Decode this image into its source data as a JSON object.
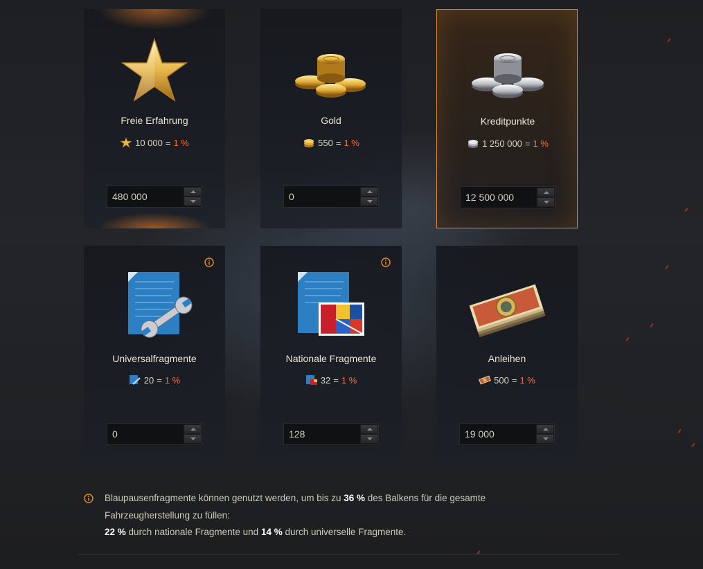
{
  "cards": [
    {
      "title": "Freie Erfahrung",
      "rate_amount": "10 000",
      "rate_equals": "=",
      "rate_percent": "1 %",
      "value": "480 000",
      "icon": "star-icon",
      "selected": false
    },
    {
      "title": "Gold",
      "rate_amount": "550",
      "rate_equals": "=",
      "rate_percent": "1 %",
      "value": "0",
      "icon": "gold-coins-icon",
      "selected": false
    },
    {
      "title": "Kreditpunkte",
      "rate_amount": "1 250 000",
      "rate_equals": "=",
      "rate_percent": "1 %",
      "value": "12 500 000",
      "icon": "silver-coins-icon",
      "selected": true
    },
    {
      "title": "Universalfragmente",
      "rate_amount": "20",
      "rate_equals": "=",
      "rate_percent": "1 %",
      "value": "0",
      "icon": "universal-blueprint-icon",
      "selected": false,
      "has_info": true
    },
    {
      "title": "Nationale Fragmente",
      "rate_amount": "32",
      "rate_equals": "=",
      "rate_percent": "1 %",
      "value": "128",
      "icon": "national-blueprint-icon",
      "selected": false,
      "has_info": true
    },
    {
      "title": "Anleihen",
      "rate_amount": "500",
      "rate_equals": "=",
      "rate_percent": "1 %",
      "value": "19 000",
      "icon": "bonds-icon",
      "selected": false
    }
  ],
  "note": {
    "line1_pre": "Blaupausenfragmente können genutzt werden, um bis zu",
    "line1_bold": "36 %",
    "line1_post": "des Balkens für die gesamte Fahrzeugherstellung zu füllen:",
    "line2_bold1": "22 %",
    "line2_mid": "durch nationale Fragmente und",
    "line2_bold2": "14 %",
    "line2_post": "durch universelle Fragmente."
  },
  "colors": {
    "accent": "#e0892c",
    "percent": "#ff6a33",
    "background": "#1b1b1d"
  }
}
